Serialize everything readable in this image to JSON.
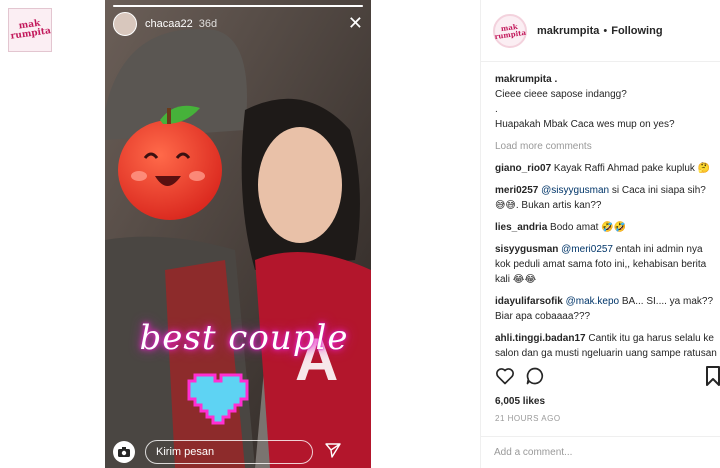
{
  "sidebar": {
    "logo_text_1": "mak",
    "logo_text_2": "rumpita"
  },
  "story": {
    "username": "chacaa22",
    "time": "36d",
    "progress": 1.0,
    "caption": "best couple",
    "message_placeholder": "Kirim pesan",
    "icons": {
      "close": "close-icon",
      "camera": "camera-icon",
      "send": "send-icon"
    }
  },
  "post": {
    "author": "makrumpita",
    "separator": "•",
    "follow_state": "Following",
    "caption_user": "makrumpita .",
    "caption_line_1": "Cieee cieee sapose indangg?",
    "caption_line_2": ".",
    "caption_line_3": "Huapakah Mbak Caca wes mup on yes?",
    "load_more": "Load more comments",
    "comments": [
      {
        "user": "giano_rio07",
        "text": "Kayak Raffi Ahmad pake kupluk 🤔"
      },
      {
        "user": "meri0257",
        "mention": "@sisyygusman",
        "text": "si Caca ini siapa sih? 😅😅. Bukan artis kan??"
      },
      {
        "user": "lies_andria",
        "text": "Bodo amat 🤣🤣"
      },
      {
        "user": "sisyygusman",
        "mention": "@meri0257",
        "text": "entah ini admin nya kok peduli amat sama foto ini,, kehabisan berita kali 😂😂"
      },
      {
        "user": "idayulifarsofik",
        "mention": "@mak.kepo",
        "text": "BA... SI.... ya mak?? Biar apa cobaaaa???"
      },
      {
        "user": "ahli.tinggi.badan17",
        "text": "Cantik itu ga harus selalu ke salon dan ga musti ngeluarin uang sampe ratusan ribu bahkan jutaan rupiah"
      }
    ],
    "likes": "6,005 likes",
    "time_ago": "21 HOURS AGO",
    "add_comment_placeholder": "Add a comment...",
    "icons": {
      "like": "heart-icon",
      "comment": "comment-icon",
      "save": "bookmark-icon"
    }
  }
}
